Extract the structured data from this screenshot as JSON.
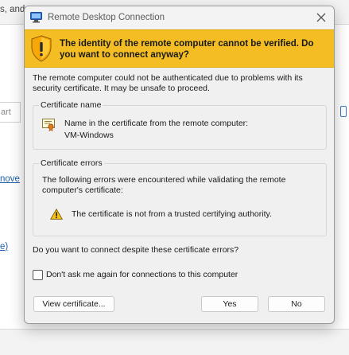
{
  "background": {
    "top_text": "s, and",
    "input_placeholder": "art",
    "link_move": "nove",
    "link_e": "e)"
  },
  "dialog": {
    "title": "Remote Desktop Connection",
    "banner": "The identity of the remote computer cannot be verified. Do you want to connect anyway?",
    "intro": "The remote computer could not be authenticated due to problems with its security certificate. It may be unsafe to proceed.",
    "certificate_group": {
      "title": "Certificate name",
      "label": "Name in the certificate from the remote computer:",
      "value": "VM-Windows"
    },
    "errors_group": {
      "title": "Certificate errors",
      "description": "The following errors were encountered while validating the remote computer's certificate:",
      "items": [
        "The certificate is not from a trusted certifying authority."
      ]
    },
    "question": "Do you want to connect despite these certificate errors?",
    "checkbox_label": "Don't ask me again for connections to this computer",
    "checkbox_checked": false,
    "buttons": {
      "view_certificate": "View certificate...",
      "yes": "Yes",
      "no": "No"
    }
  },
  "colors": {
    "banner": "#f3bd23",
    "shield": "#f0a30a",
    "link": "#1f5ea8"
  },
  "icons": [
    "remote-desktop-icon",
    "close-icon",
    "warning-shield-icon",
    "certificate-icon",
    "alert-triangle-icon"
  ]
}
